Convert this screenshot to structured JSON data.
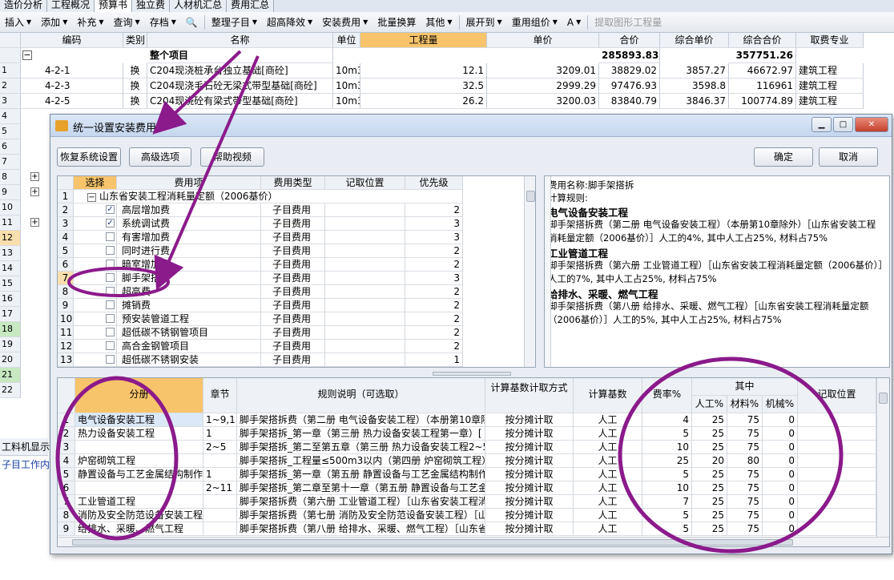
{
  "tabs": [
    "造价分析",
    "工程概况",
    "预算书",
    "独立费",
    "人材机汇总",
    "费用汇总"
  ],
  "active_tab": 2,
  "toolbar": {
    "items": [
      {
        "label": "插入",
        "caret": true
      },
      {
        "label": "添加",
        "caret": true
      },
      {
        "label": "补充",
        "caret": true
      },
      {
        "label": "查询",
        "caret": true
      },
      {
        "label": "存档",
        "caret": true
      },
      {
        "label": "🔍",
        "caret": false
      },
      {
        "label": "整理子目",
        "caret": true
      },
      {
        "label": "超高降效",
        "caret": true
      },
      {
        "label": "安装费用",
        "caret": true
      },
      {
        "label": "批量换算",
        "caret": false
      },
      {
        "label": "其他",
        "caret": true
      },
      {
        "label": "展开到",
        "caret": true
      },
      {
        "label": "重用组价",
        "caret": true
      },
      {
        "label": "A",
        "caret": true
      },
      {
        "label": "提取图形工程量",
        "caret": false,
        "disabled": true
      }
    ]
  },
  "main_grid": {
    "headers": [
      "编码",
      "类别",
      "名称",
      "单位",
      "工程量",
      "单价",
      "合价",
      "综合单价",
      "综合合价",
      "取费专业"
    ],
    "total_row": {
      "name": "整个项目",
      "total": "285893.83",
      "comp_total": "357751.26"
    },
    "rows": [
      {
        "n": "1",
        "code": "4-2-1",
        "type": "换",
        "name": "C204现浇桩承台独立基础[商砼]",
        "unit": "10m3",
        "qty": "12.1",
        "price": "3209.01",
        "sum": "38829.02",
        "cprice": "3857.27",
        "csum": "46672.97",
        "spec": "建筑工程"
      },
      {
        "n": "2",
        "code": "4-2-3",
        "type": "换",
        "name": "C204现浇毛石砼无梁式带型基础[商砼]",
        "unit": "10m3",
        "qty": "32.5",
        "price": "2999.29",
        "sum": "97476.93",
        "cprice": "3598.8",
        "csum": "116961",
        "spec": "建筑工程"
      },
      {
        "n": "3",
        "code": "4-2-5",
        "type": "换",
        "name": "C204现浇砼有梁式带型基础[商砼]",
        "unit": "10m3",
        "qty": "26.2",
        "price": "3200.03",
        "sum": "83840.79",
        "cprice": "3846.37",
        "csum": "100774.89",
        "spec": "建筑工程"
      }
    ],
    "row_numbers": [
      "4",
      "5",
      "6",
      "7",
      "8",
      "9",
      "10",
      "11",
      "12",
      "13",
      "14",
      "15",
      "16",
      "17",
      "18",
      "19",
      "20",
      "21",
      "22"
    ]
  },
  "left_panel": {
    "label1": "工料机显示",
    "label2": "子目工作内容"
  },
  "dialog": {
    "title": "统一设置安装费用",
    "buttons": {
      "restore": "恢复系统设置",
      "advanced": "高级选项",
      "help": "帮助视频",
      "ok": "确定",
      "cancel": "取消"
    },
    "fee_table": {
      "headers": [
        "选择",
        "费用项",
        "费用类型",
        "记取位置",
        "优先级"
      ],
      "group": "山东省安装工程消耗量定额（2006基价）",
      "rows": [
        {
          "n": "2",
          "checked": true,
          "name": "高层增加费",
          "type": "子目费用",
          "pri": "2"
        },
        {
          "n": "3",
          "checked": true,
          "name": "系统调试费",
          "type": "子目费用",
          "pri": "3"
        },
        {
          "n": "4",
          "checked": false,
          "name": "有害增加费",
          "type": "子目费用",
          "pri": "3"
        },
        {
          "n": "5",
          "checked": false,
          "name": "同时进行费",
          "type": "子目费用",
          "pri": "2"
        },
        {
          "n": "6",
          "checked": false,
          "name": "暗室增加费",
          "type": "子目费用",
          "pri": "2"
        },
        {
          "n": "7",
          "checked": false,
          "name": "脚手架搭拆",
          "type": "子目费用",
          "pri": "3"
        },
        {
          "n": "8",
          "checked": false,
          "name": "超高费",
          "type": "子目费用",
          "pri": "2"
        },
        {
          "n": "9",
          "checked": false,
          "name": "摊销费",
          "type": "子目费用",
          "pri": "2"
        },
        {
          "n": "10",
          "checked": false,
          "name": "预安装管道工程",
          "type": "子目费用",
          "pri": "2"
        },
        {
          "n": "11",
          "checked": false,
          "name": "超低碳不锈钢管项目",
          "type": "子目费用",
          "pri": "2"
        },
        {
          "n": "12",
          "checked": false,
          "name": "高合金钢管项目",
          "type": "子目费用",
          "pri": "2"
        },
        {
          "n": "13",
          "checked": false,
          "name": "超低碳不锈钢安装",
          "type": "子目费用",
          "pri": "1"
        }
      ]
    },
    "info": {
      "fee_name": "费用名称:脚手架搭拆",
      "rule_label": "计算规则:",
      "sections": [
        {
          "title": "电气设备安装工程",
          "lines": [
            "脚手架搭拆费（第二册 电气设备安装工程）（本册第10章除外）［山东省安装工程",
            "消耗量定额（2006基价）］人工的4%, 其中人工占25%, 材料占75%"
          ]
        },
        {
          "title": "工业管道工程",
          "lines": [
            "脚手架搭拆费（第六册 工业管道工程）［山东省安装工程消耗量定额（2006基价）］",
            "人工的7%, 其中人工占25%, 材料占75%"
          ]
        },
        {
          "title": "给排水、采暖、燃气工程",
          "lines": [
            "脚手架搭拆费（第八册 给排水、采暖、燃气工程）［山东省安装工程消耗量定额",
            "（2006基价）］人工的5%, 其中人工占25%, 材料占75%"
          ]
        }
      ]
    },
    "rule_table": {
      "headers": {
        "volume": "分册",
        "chapter": "章节",
        "rule": "规则说明（可选取）",
        "method": "计算基数计取方式",
        "base": "计算基数",
        "rate": "费率%",
        "among": "其中",
        "labor": "人工%",
        "material": "材料%",
        "machine": "机械%",
        "position": "记取位置"
      },
      "rows": [
        {
          "n": "1",
          "volume": "电气设备安装工程",
          "chapter": "1~9,11",
          "rule": "脚手架搭拆费（第二册 电气设备安装工程）（本册第10章除",
          "method": "按分摊计取",
          "base": "人工",
          "rate": "4",
          "labor": "25",
          "material": "75",
          "machine": "0"
        },
        {
          "n": "2",
          "volume": "热力设备安装工程",
          "chapter": "1",
          "rule": "脚手架搭拆_第一章（第三册 热力设备安装工程第一章）[",
          "method": "按分摊计取",
          "base": "人工",
          "rate": "5",
          "labor": "25",
          "material": "75",
          "machine": "0"
        },
        {
          "n": "3",
          "volume": "",
          "chapter": "2~5",
          "rule": "脚手架搭拆_第二至第五章（第三册 热力设备安装工程2~5",
          "method": "按分摊计取",
          "base": "人工",
          "rate": "10",
          "labor": "25",
          "material": "75",
          "machine": "0"
        },
        {
          "n": "4",
          "volume": "炉窑砌筑工程",
          "chapter": "",
          "rule": "脚手架搭拆_工程量≤500m3以内（第四册 炉窑砌筑工程）[",
          "method": "按分摊计取",
          "base": "人工",
          "rate": "25",
          "labor": "20",
          "material": "80",
          "machine": "0"
        },
        {
          "n": "5",
          "volume": "静置设备与工艺金属结构制作安装工程",
          "chapter": "1",
          "rule": "脚手架搭拆_第一章（第五册 静置设备与工艺金属结构制作",
          "method": "按分摊计取",
          "base": "人工",
          "rate": "5",
          "labor": "25",
          "material": "75",
          "machine": "0"
        },
        {
          "n": "6",
          "volume": "",
          "chapter": "2~11",
          "rule": "脚手架搭拆_第二章至第十一章（第五册 静置设备与工艺金",
          "method": "按分摊计取",
          "base": "人工",
          "rate": "10",
          "labor": "25",
          "material": "75",
          "machine": "0"
        },
        {
          "n": "7",
          "volume": "工业管道工程",
          "chapter": "",
          "rule": "脚手架搭拆费（第六册 工业管道工程）［山东省安装工程消",
          "method": "按分摊计取",
          "base": "人工",
          "rate": "7",
          "labor": "25",
          "material": "75",
          "machine": "0"
        },
        {
          "n": "8",
          "volume": "消防及安全防范设备安装工程",
          "chapter": "",
          "rule": "脚手架搭拆费（第七册 消防及安全防范设备安装工程）［山",
          "method": "按分摊计取",
          "base": "人工",
          "rate": "5",
          "labor": "25",
          "material": "75",
          "machine": "0"
        },
        {
          "n": "9",
          "volume": "给排水、采暖、燃气工程",
          "chapter": "",
          "rule": "脚手架搭拆费（第八册 给排水、采暖、燃气工程）［山东省",
          "method": "按分摊计取",
          "base": "人工",
          "rate": "5",
          "labor": "25",
          "material": "75",
          "machine": "0"
        }
      ]
    }
  },
  "colors": {
    "annotation": "#8b1a8b",
    "header_highlight": "#f7c46c",
    "selection": "#f9dfad"
  }
}
